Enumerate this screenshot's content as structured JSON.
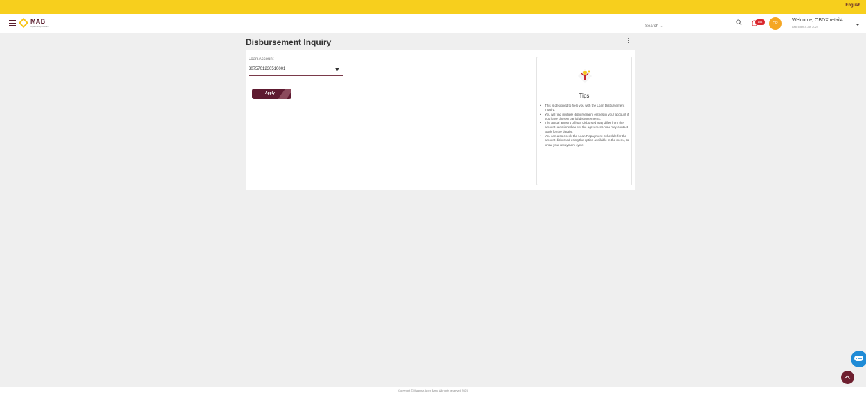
{
  "topbar": {
    "language": "English",
    "color": "#f7cf1d"
  },
  "header": {
    "brand": {
      "name": "MAB",
      "tagline": "Myanma Apex Bank"
    },
    "search": {
      "placeholder": "Search ..."
    },
    "notifications": {
      "count": "154"
    },
    "user": {
      "initials": "OR",
      "welcome": "Welcome, OBDX retail4",
      "last_login": "Last login 3 Jan 2024"
    }
  },
  "page": {
    "title": "Disbursement Inquiry",
    "loan_account": {
      "label": "Loan Account",
      "value": "3075701230510001"
    },
    "apply_label": "Apply",
    "tips": {
      "title": "Tips",
      "items": [
        "This is designed to help you with the Loan Disbursement Inquiry.",
        "You will find multiple disbursement entries in your account if you have chosen partial disbursements.",
        "The actual amount of loan disbursed may differ from the amount sanctioned as per the agreement. You may contact Bank for the details.",
        "You can also check the Loan Repayment Schedule for the amount disbursed using the option available in the menu, to know your repayment cycle."
      ]
    }
  },
  "footer": {
    "copyright": "Copyright © Myanma Apex Bank All rights reserved 2023"
  },
  "colors": {
    "brand_maroon": "#5e1a30",
    "brand_yellow": "#f7cf1d",
    "chat_blue": "#1f8bd6"
  }
}
